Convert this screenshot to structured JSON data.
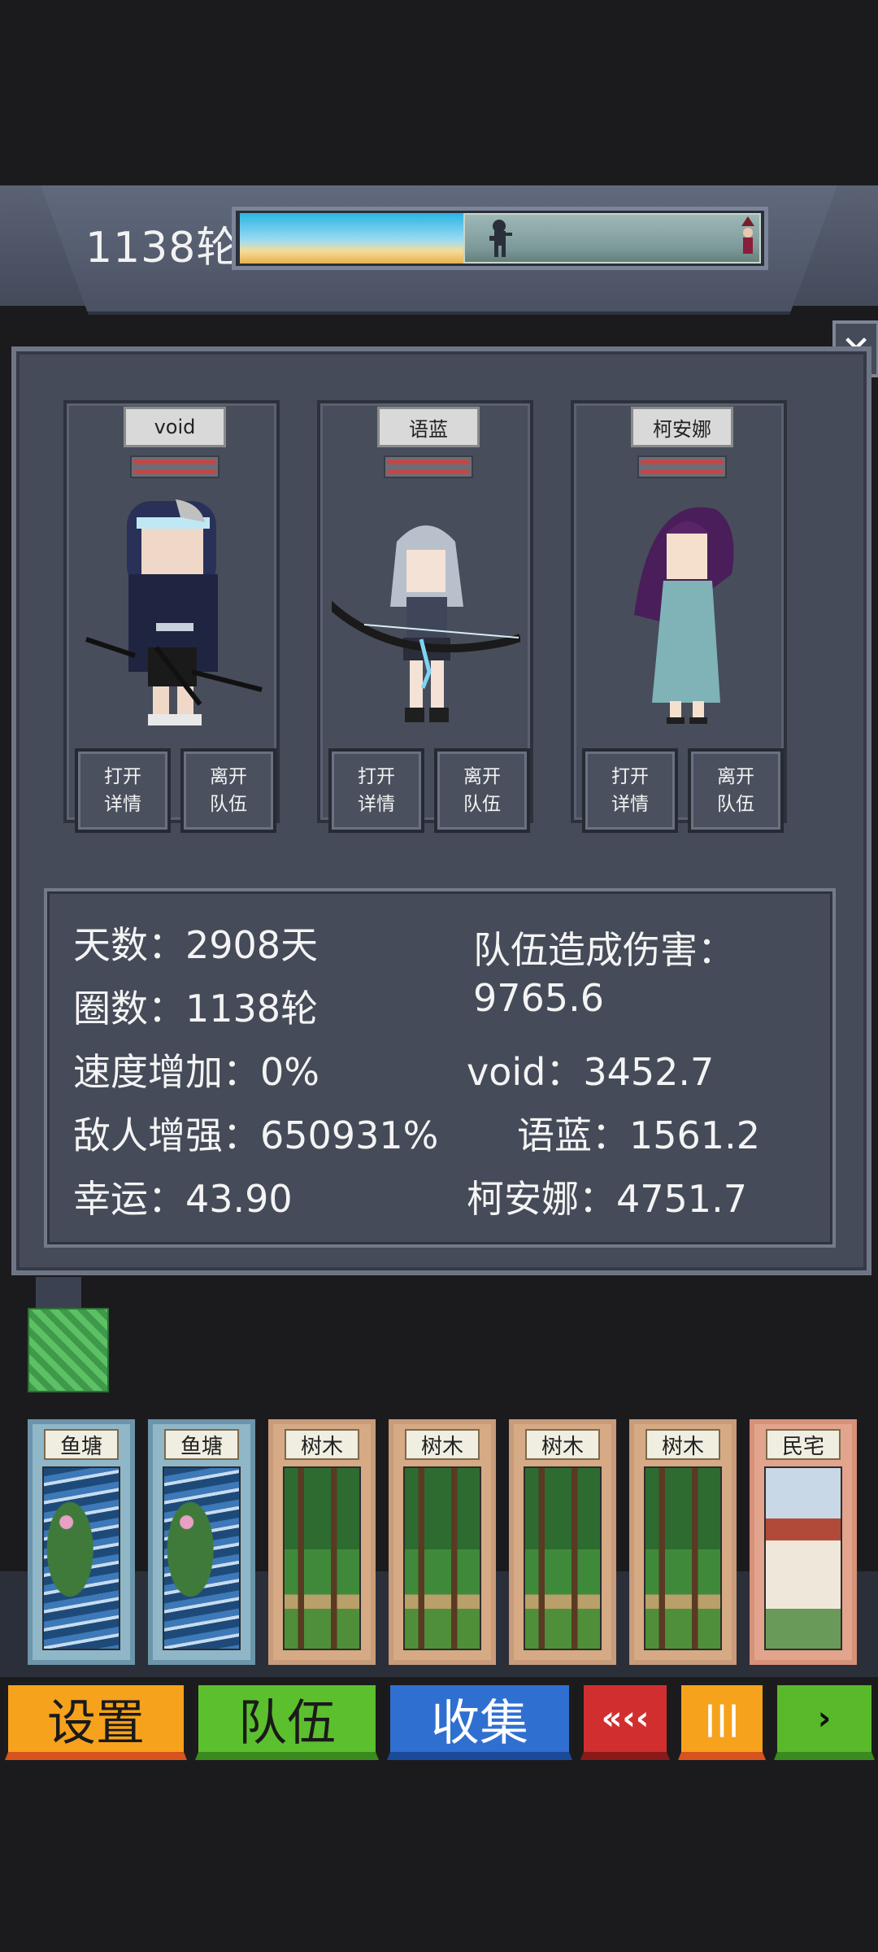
{
  "header": {
    "round_text": "1138轮"
  },
  "close_label": "✕",
  "team": [
    {
      "name": "void",
      "open_label": [
        "打开",
        "详情"
      ],
      "leave_label": [
        "离开",
        "队伍"
      ]
    },
    {
      "name": "语蓝",
      "open_label": [
        "打开",
        "详情"
      ],
      "leave_label": [
        "离开",
        "队伍"
      ]
    },
    {
      "name": "柯安娜",
      "open_label": [
        "打开",
        "详情"
      ],
      "leave_label": [
        "离开",
        "队伍"
      ]
    }
  ],
  "stats": {
    "days": "天数：2908天",
    "rounds": "圈数：1138轮",
    "speed": "速度增加：0%",
    "enemy": "敌人增强：650931%",
    "luck": "幸运：43.90",
    "team_damage_label": "队伍造成伤害：",
    "team_damage_value": "9765.6",
    "void_dmg": "void：3452.7",
    "yulan_dmg": "语蓝：1561.2",
    "keanna_dmg": "柯安娜：4751.7"
  },
  "cards": [
    {
      "title": "鱼塘",
      "kind": "pond"
    },
    {
      "title": "鱼塘",
      "kind": "pond"
    },
    {
      "title": "树木",
      "kind": "forest"
    },
    {
      "title": "树木",
      "kind": "forest"
    },
    {
      "title": "树木",
      "kind": "forest"
    },
    {
      "title": "树木",
      "kind": "forest"
    },
    {
      "title": "民宅",
      "kind": "house"
    }
  ],
  "buttons": {
    "settings": "设置",
    "team": "队伍",
    "collect": "收集",
    "rewind": "«‹‹",
    "pause": "|||",
    "play": "›"
  },
  "colors": {
    "settings": "#f6a21c",
    "team": "#5cbf2e",
    "collect": "#2f6fd0",
    "rewind": "#d12f2f"
  }
}
